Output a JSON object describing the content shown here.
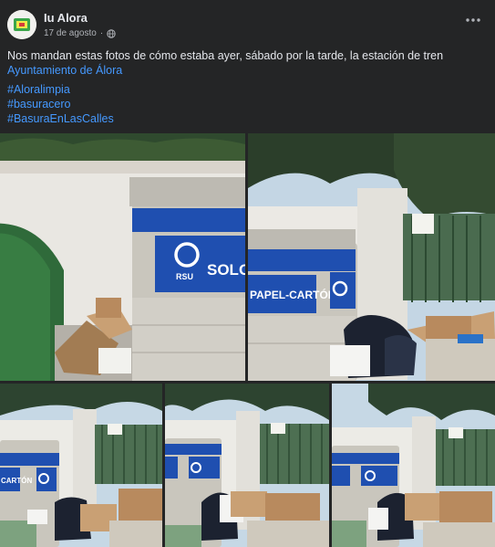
{
  "post": {
    "page_name": "Iu Alora",
    "date": "17 de agosto",
    "separator": "·",
    "text": "Nos mandan estas fotos de cómo estaba ayer, sábado por la tarde, la estación de tren",
    "mention": "Ayuntamiento de Álora",
    "hashtags": [
      "#Aloralimpia",
      "#basuracero",
      "#BasuraEnLasCalles"
    ]
  },
  "photos": {
    "bin_label_left": "SOLO P",
    "bin_label_right": "PAPEL-CARTÓN",
    "bin_label_small": "CARTÓN",
    "rsu": "RSU"
  },
  "colors": {
    "bin_blue": "#1f4fb0",
    "accent_link": "#4599ff"
  },
  "icons": {
    "visibility": "globe-icon",
    "options": "more-options-icon"
  }
}
